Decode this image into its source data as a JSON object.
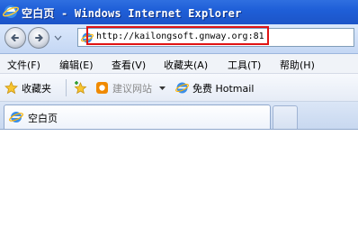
{
  "window": {
    "title": "空白页 - Windows Internet Explorer"
  },
  "navigation": {
    "address": "http://kailongsoft.gnway.org:81"
  },
  "menu": {
    "items": [
      {
        "label": "文件(F)"
      },
      {
        "label": "编辑(E)"
      },
      {
        "label": "查看(V)"
      },
      {
        "label": "收藏夹(A)"
      },
      {
        "label": "工具(T)"
      },
      {
        "label": "帮助(H)"
      }
    ]
  },
  "favorites_bar": {
    "favorites_label": "收藏夹",
    "suggested_sites_label": "建议网站",
    "free_hotmail_label": "免费 Hotmail"
  },
  "tabs": [
    {
      "label": "空白页"
    }
  ],
  "colors": {
    "title_bar": "#1f5fd8",
    "highlight_box": "#e01414",
    "suggested_sites_icon": "#f08a00"
  },
  "icons": [
    "ie-icon",
    "back-arrow-icon",
    "forward-arrow-icon",
    "page-icon",
    "star-icon",
    "add-favorite-icon",
    "suggested-sites-icon",
    "hotmail-icon",
    "blank-page-icon"
  ]
}
